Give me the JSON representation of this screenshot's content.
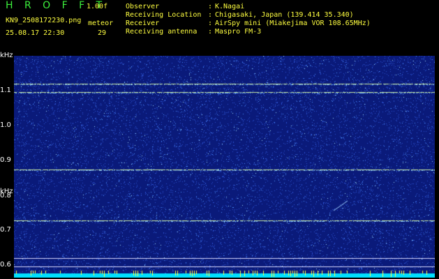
{
  "header": {
    "brand": "H R O F F T",
    "version": "1.00f",
    "file": "KN9_2508172230.png",
    "meteor_label": "meteor",
    "datetime": "25.08.17 22:30",
    "meteor_count": "29"
  },
  "meta": [
    {
      "label": "Observer",
      "value": "K.Nagai"
    },
    {
      "label": "Receiving Location",
      "value": "Chigasaki, Japan (139.414 35.340)"
    },
    {
      "label": "Receiver",
      "value": "AirSpy mini (Miakejima VOR 108.65MHz)"
    },
    {
      "label": "Receiving antenna",
      "value": "Maspro FM-3"
    }
  ],
  "axis": {
    "unit": "kHz",
    "y_ticks": [
      "1.1",
      "1.0",
      "0.9",
      "0.8",
      "0.7",
      "0.6"
    ],
    "x_ticks": [
      "2231",
      "2232",
      "2233",
      "2234",
      "2235",
      "2236",
      "2237",
      "2238",
      "2239",
      "2240"
    ]
  },
  "colors": {
    "background": "#0a1a7a",
    "noise": "#3a6aff",
    "line": "#c8e8a0",
    "baseline": "#00e0ff",
    "tick": "#ffff40"
  }
}
